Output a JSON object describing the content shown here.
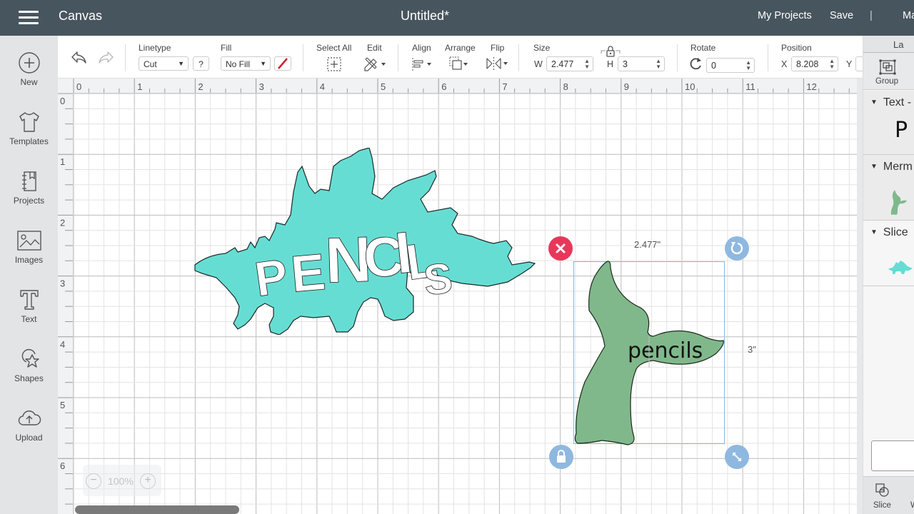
{
  "topbar": {
    "app_name": "Canvas",
    "document_title": "Untitled*",
    "my_projects": "My Projects",
    "save": "Save",
    "divider": "|",
    "make_it": "Ma"
  },
  "sidebar": {
    "items": [
      {
        "label": "New",
        "icon": "plus-circle-icon"
      },
      {
        "label": "Templates",
        "icon": "tshirt-icon"
      },
      {
        "label": "Projects",
        "icon": "notebook-icon"
      },
      {
        "label": "Images",
        "icon": "image-icon"
      },
      {
        "label": "Text",
        "icon": "text-t-icon"
      },
      {
        "label": "Shapes",
        "icon": "shapes-icon"
      },
      {
        "label": "Upload",
        "icon": "cloud-upload-icon"
      }
    ]
  },
  "toolbar": {
    "linetype_label": "Linetype",
    "linetype_value": "Cut",
    "help": "?",
    "fill_label": "Fill",
    "fill_value": "No Fill",
    "select_all_label": "Select All",
    "edit_label": "Edit",
    "align_label": "Align",
    "arrange_label": "Arrange",
    "flip_label": "Flip",
    "size_label": "Size",
    "w_label": "W",
    "w_value": "2.477",
    "h_label": "H",
    "h_value": "3",
    "rotate_label": "Rotate",
    "rotate_value": "0",
    "position_label": "Position",
    "x_label": "X",
    "x_value": "8.208",
    "y_label": "Y",
    "colors": {
      "no_fill_slash": "#d0202e"
    }
  },
  "ruler": {
    "horizontal": [
      "0",
      "1",
      "2",
      "3",
      "4",
      "5",
      "6",
      "7",
      "8",
      "9",
      "10",
      "11",
      "12"
    ],
    "vertical": [
      "0",
      "1",
      "2",
      "3",
      "4",
      "5",
      "6"
    ]
  },
  "canvas": {
    "stegosaurus_text": "PENCILS",
    "stegosaurus_color": "#66ddd3",
    "mermaid_text": "pencils",
    "mermaid_color": "#80b88b",
    "selection": {
      "width_label": "2.477\"",
      "height_label": "3\"",
      "delete_color": "#e8385a",
      "handle_color": "#8fb8e0"
    }
  },
  "zoom": {
    "minus": "−",
    "value": "100%",
    "plus": "+"
  },
  "layers_panel": {
    "tab_label": "Layers",
    "tab_visible": "La",
    "group_label": "Group",
    "layers": [
      {
        "title": "Text -",
        "thumb": "P"
      },
      {
        "title": "Merm",
        "thumb": "mermaid-tail"
      },
      {
        "title": "Slice",
        "thumb": "stegosaurus"
      }
    ],
    "bottom_actions": [
      {
        "label": "Slice"
      },
      {
        "label": "W"
      }
    ]
  }
}
